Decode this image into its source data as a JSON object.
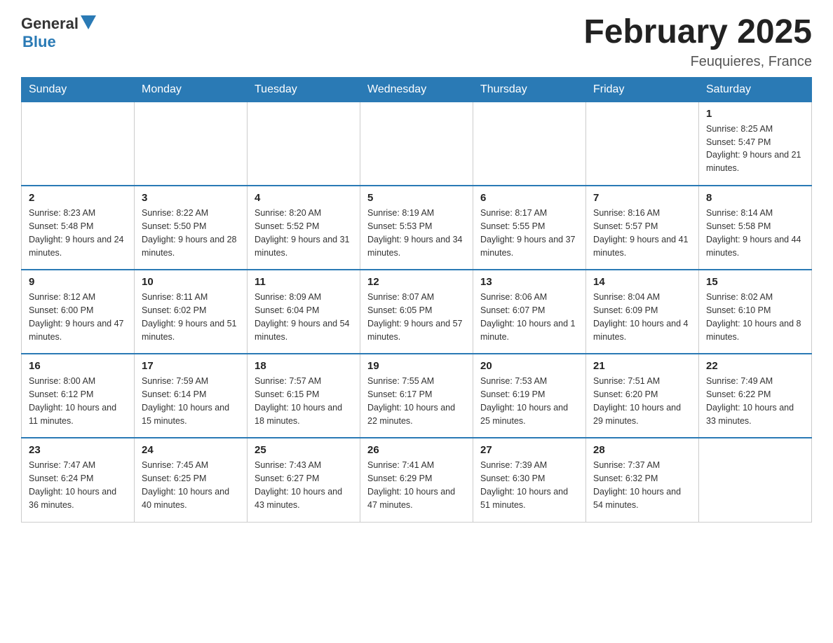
{
  "header": {
    "logo_general": "General",
    "logo_arrow": "▶",
    "logo_blue": "Blue",
    "title": "February 2025",
    "subtitle": "Feuquieres, France"
  },
  "days_of_week": [
    "Sunday",
    "Monday",
    "Tuesday",
    "Wednesday",
    "Thursday",
    "Friday",
    "Saturday"
  ],
  "weeks": [
    [
      {
        "day": "",
        "info": ""
      },
      {
        "day": "",
        "info": ""
      },
      {
        "day": "",
        "info": ""
      },
      {
        "day": "",
        "info": ""
      },
      {
        "day": "",
        "info": ""
      },
      {
        "day": "",
        "info": ""
      },
      {
        "day": "1",
        "info": "Sunrise: 8:25 AM\nSunset: 5:47 PM\nDaylight: 9 hours and 21 minutes."
      }
    ],
    [
      {
        "day": "2",
        "info": "Sunrise: 8:23 AM\nSunset: 5:48 PM\nDaylight: 9 hours and 24 minutes."
      },
      {
        "day": "3",
        "info": "Sunrise: 8:22 AM\nSunset: 5:50 PM\nDaylight: 9 hours and 28 minutes."
      },
      {
        "day": "4",
        "info": "Sunrise: 8:20 AM\nSunset: 5:52 PM\nDaylight: 9 hours and 31 minutes."
      },
      {
        "day": "5",
        "info": "Sunrise: 8:19 AM\nSunset: 5:53 PM\nDaylight: 9 hours and 34 minutes."
      },
      {
        "day": "6",
        "info": "Sunrise: 8:17 AM\nSunset: 5:55 PM\nDaylight: 9 hours and 37 minutes."
      },
      {
        "day": "7",
        "info": "Sunrise: 8:16 AM\nSunset: 5:57 PM\nDaylight: 9 hours and 41 minutes."
      },
      {
        "day": "8",
        "info": "Sunrise: 8:14 AM\nSunset: 5:58 PM\nDaylight: 9 hours and 44 minutes."
      }
    ],
    [
      {
        "day": "9",
        "info": "Sunrise: 8:12 AM\nSunset: 6:00 PM\nDaylight: 9 hours and 47 minutes."
      },
      {
        "day": "10",
        "info": "Sunrise: 8:11 AM\nSunset: 6:02 PM\nDaylight: 9 hours and 51 minutes."
      },
      {
        "day": "11",
        "info": "Sunrise: 8:09 AM\nSunset: 6:04 PM\nDaylight: 9 hours and 54 minutes."
      },
      {
        "day": "12",
        "info": "Sunrise: 8:07 AM\nSunset: 6:05 PM\nDaylight: 9 hours and 57 minutes."
      },
      {
        "day": "13",
        "info": "Sunrise: 8:06 AM\nSunset: 6:07 PM\nDaylight: 10 hours and 1 minute."
      },
      {
        "day": "14",
        "info": "Sunrise: 8:04 AM\nSunset: 6:09 PM\nDaylight: 10 hours and 4 minutes."
      },
      {
        "day": "15",
        "info": "Sunrise: 8:02 AM\nSunset: 6:10 PM\nDaylight: 10 hours and 8 minutes."
      }
    ],
    [
      {
        "day": "16",
        "info": "Sunrise: 8:00 AM\nSunset: 6:12 PM\nDaylight: 10 hours and 11 minutes."
      },
      {
        "day": "17",
        "info": "Sunrise: 7:59 AM\nSunset: 6:14 PM\nDaylight: 10 hours and 15 minutes."
      },
      {
        "day": "18",
        "info": "Sunrise: 7:57 AM\nSunset: 6:15 PM\nDaylight: 10 hours and 18 minutes."
      },
      {
        "day": "19",
        "info": "Sunrise: 7:55 AM\nSunset: 6:17 PM\nDaylight: 10 hours and 22 minutes."
      },
      {
        "day": "20",
        "info": "Sunrise: 7:53 AM\nSunset: 6:19 PM\nDaylight: 10 hours and 25 minutes."
      },
      {
        "day": "21",
        "info": "Sunrise: 7:51 AM\nSunset: 6:20 PM\nDaylight: 10 hours and 29 minutes."
      },
      {
        "day": "22",
        "info": "Sunrise: 7:49 AM\nSunset: 6:22 PM\nDaylight: 10 hours and 33 minutes."
      }
    ],
    [
      {
        "day": "23",
        "info": "Sunrise: 7:47 AM\nSunset: 6:24 PM\nDaylight: 10 hours and 36 minutes."
      },
      {
        "day": "24",
        "info": "Sunrise: 7:45 AM\nSunset: 6:25 PM\nDaylight: 10 hours and 40 minutes."
      },
      {
        "day": "25",
        "info": "Sunrise: 7:43 AM\nSunset: 6:27 PM\nDaylight: 10 hours and 43 minutes."
      },
      {
        "day": "26",
        "info": "Sunrise: 7:41 AM\nSunset: 6:29 PM\nDaylight: 10 hours and 47 minutes."
      },
      {
        "day": "27",
        "info": "Sunrise: 7:39 AM\nSunset: 6:30 PM\nDaylight: 10 hours and 51 minutes."
      },
      {
        "day": "28",
        "info": "Sunrise: 7:37 AM\nSunset: 6:32 PM\nDaylight: 10 hours and 54 minutes."
      },
      {
        "day": "",
        "info": ""
      }
    ]
  ]
}
